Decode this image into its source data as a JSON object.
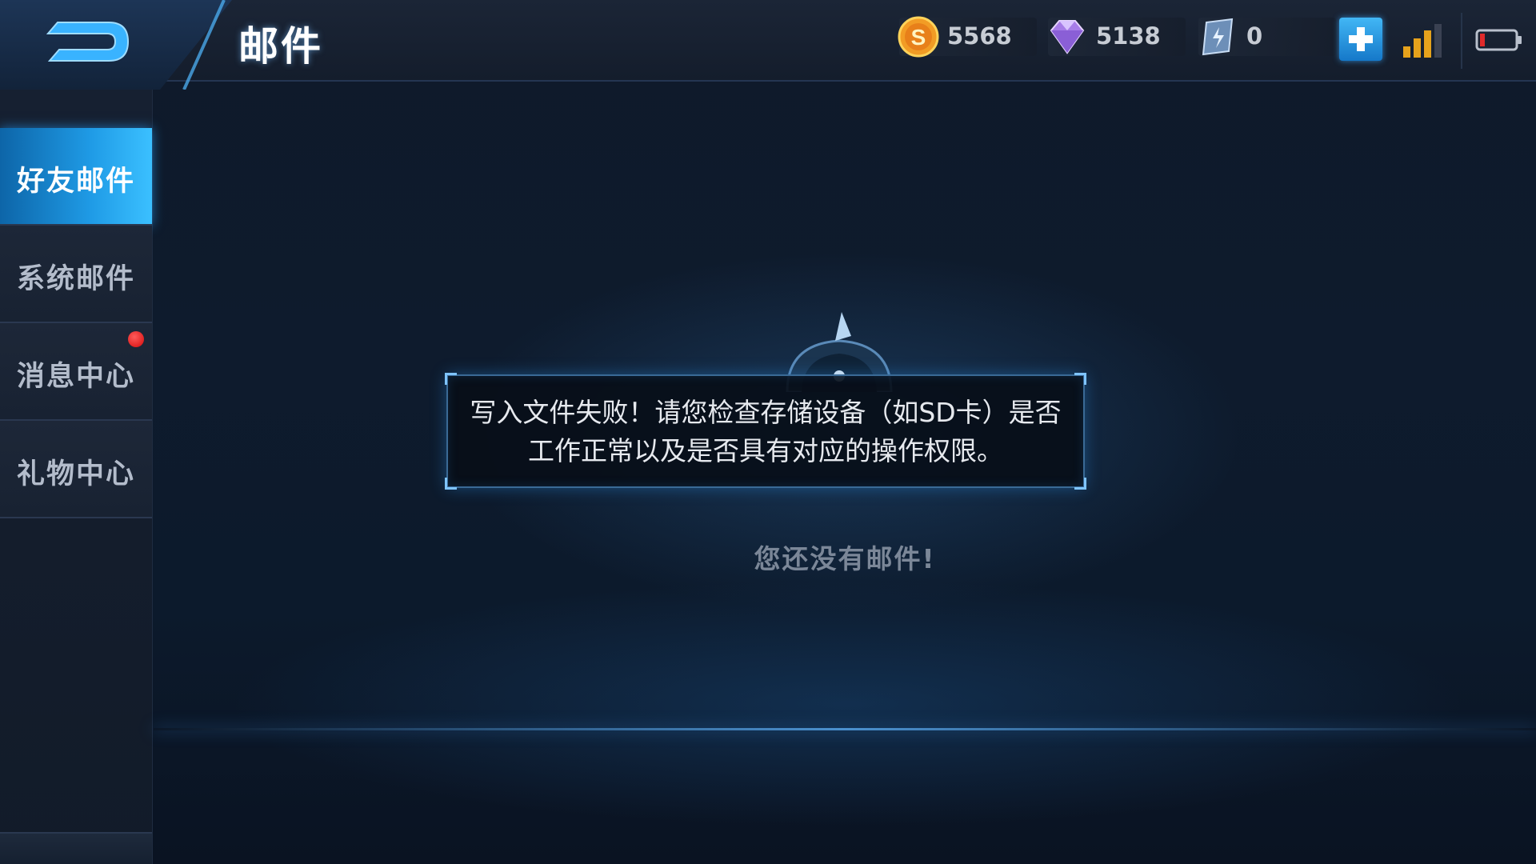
{
  "header": {
    "title": "邮件",
    "back_icon": "back-arrow-icon"
  },
  "currencies": {
    "gold": {
      "icon": "gold-coin-icon",
      "value": "5568"
    },
    "diamond": {
      "icon": "diamond-icon",
      "value": "5138"
    },
    "coupon": {
      "icon": "coupon-icon",
      "value": "0"
    }
  },
  "status": {
    "signal_icon": "signal-bars-icon",
    "battery_icon": "battery-low-icon"
  },
  "sidebar": {
    "items": [
      {
        "label": "好友邮件",
        "active": true
      },
      {
        "label": "系统邮件",
        "active": false
      },
      {
        "label": "消息中心",
        "active": false,
        "has_notification": true
      },
      {
        "label": "礼物中心",
        "active": false
      }
    ]
  },
  "dialog": {
    "message": "写入文件失败！请您检查存储设备（如SD卡）是否工作正常以及是否具有对应的操作权限。"
  },
  "main": {
    "empty_text": "您还没有邮件!"
  },
  "colors": {
    "accent": "#1f9be6",
    "notification": "#e01414",
    "gold": "#f2a12a",
    "diamond": "#b58cf0"
  }
}
